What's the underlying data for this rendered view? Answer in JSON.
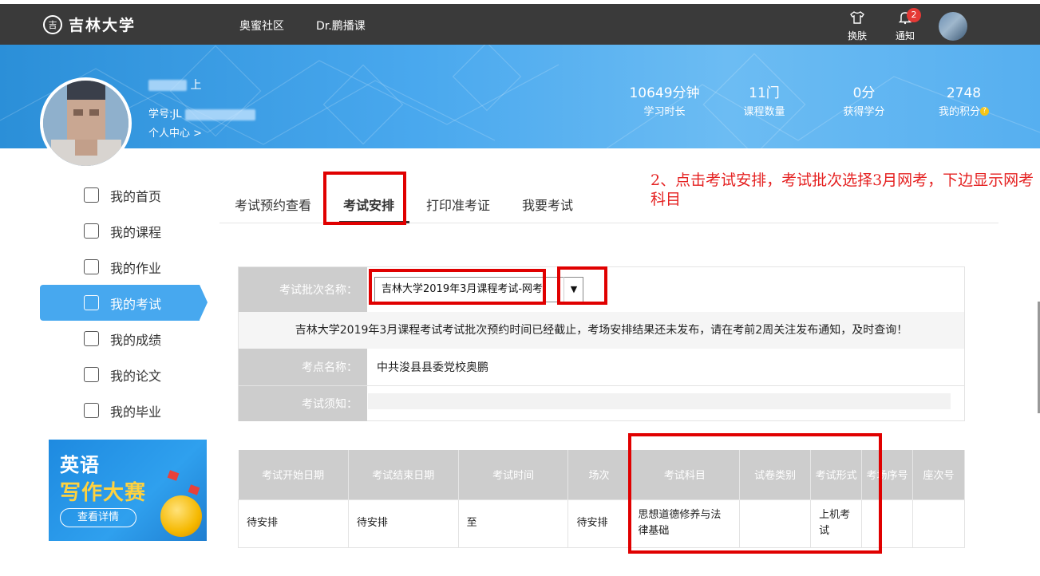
{
  "topbar": {
    "logo_seal": "吉",
    "logo_text": "吉林大学",
    "nav": [
      "奥蜜社区",
      "Dr.鹏播课"
    ],
    "skin_label": "换肤",
    "notify_label": "通知",
    "notify_count": "2"
  },
  "banner": {
    "name_suffix": "上",
    "student_id_label": "学号:JL",
    "personal_center": "个人中心 >",
    "stats": [
      {
        "value": "10649分钟",
        "label": "学习时长"
      },
      {
        "value": "11门",
        "label": "课程数量"
      },
      {
        "value": "0分",
        "label": "获得学分"
      },
      {
        "value": "2748",
        "label": "我的积分"
      }
    ]
  },
  "sidebar": {
    "items": [
      {
        "label": "我的首页",
        "icon": "home-icon"
      },
      {
        "label": "我的课程",
        "icon": "course-icon"
      },
      {
        "label": "我的作业",
        "icon": "homework-icon"
      },
      {
        "label": "我的考试",
        "icon": "exam-icon"
      },
      {
        "label": "我的成绩",
        "icon": "grade-icon"
      },
      {
        "label": "我的论文",
        "icon": "thesis-icon"
      },
      {
        "label": "我的毕业",
        "icon": "graduation-icon"
      }
    ],
    "active_index": 3
  },
  "ad": {
    "line1": "英语",
    "line2": "写作大赛",
    "button": "查看详情"
  },
  "tabs": [
    "考试预约查看",
    "考试安排",
    "打印准考证",
    "我要考试"
  ],
  "annotation": "2、点击考试安排，考试批次选择3月网考，下边显示网考科目",
  "form": {
    "batch_label": "考试批次名称：",
    "batch_value": "吉林大学2019年3月课程考试-网考",
    "notice": "吉林大学2019年3月课程考试考试批次预约时间已经截止，考场安排结果还未发布，请在考前2周关注发布通知，及时查询！",
    "site_label": "考点名称：",
    "site_value": "中共浚县县委党校奥鹏",
    "notes_label": "考试须知："
  },
  "table": {
    "headers": [
      "考试开始日期",
      "考试结束日期",
      "考试时间",
      "场次",
      "考试科目",
      "试卷类别",
      "考试形式",
      "考场序号",
      "座次号"
    ],
    "rows": [
      [
        "待安排",
        "待安排",
        "至",
        "待安排",
        "思想道德修养与法律基础",
        "",
        "上机考试",
        "",
        ""
      ]
    ]
  },
  "colors": {
    "topbar": "#3a3a3a",
    "accent": "#47a8ef",
    "annotation_red": "#e00000",
    "header_gray": "#cdcdcd"
  }
}
